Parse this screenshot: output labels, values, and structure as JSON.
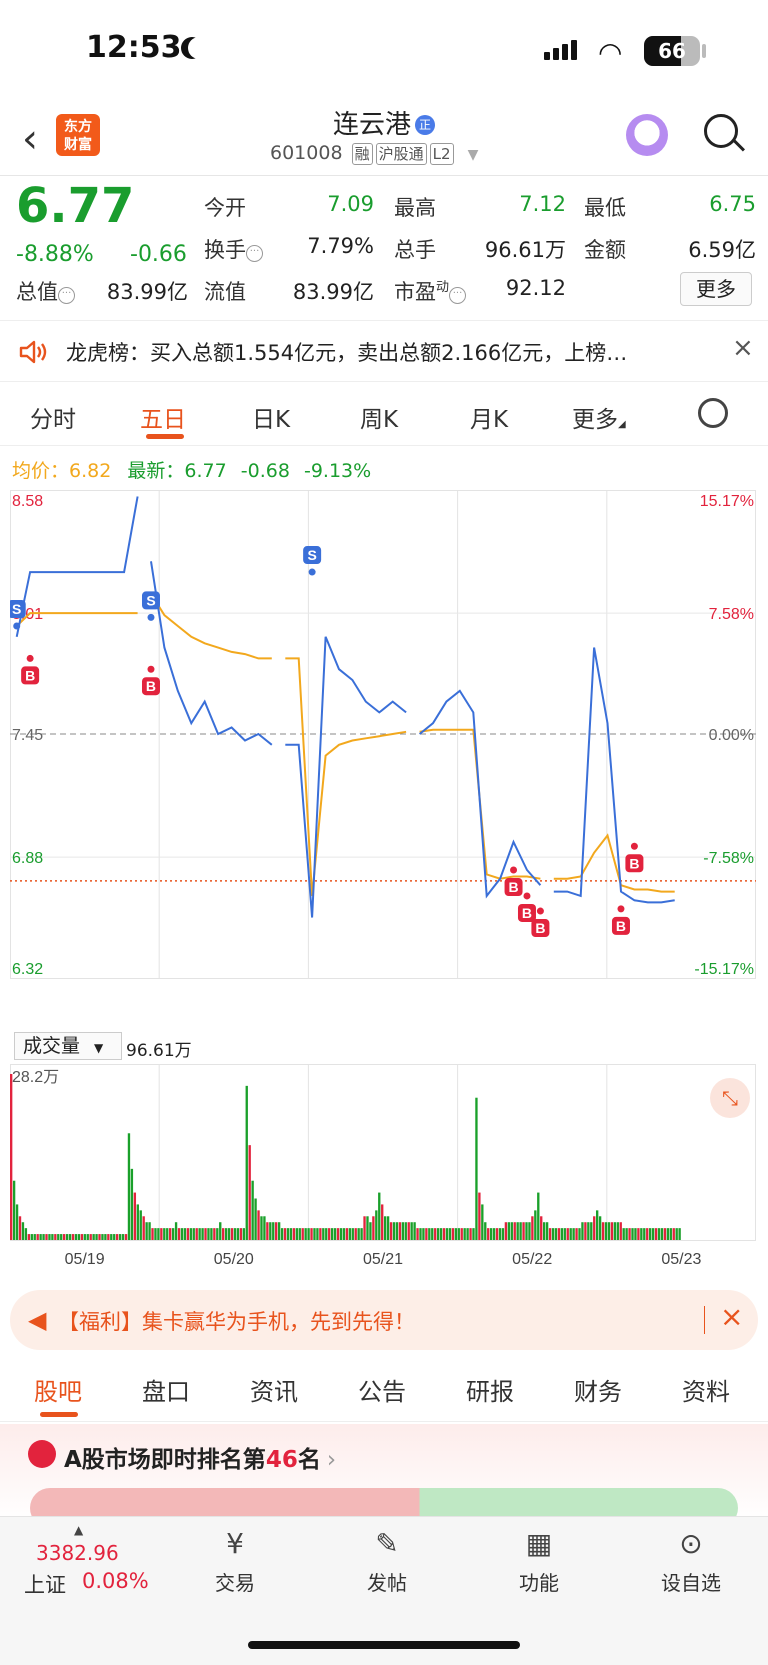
{
  "status_bar": {
    "time": "12:53",
    "battery": "66"
  },
  "header": {
    "logo_line1": "东方",
    "logo_line2": "财富",
    "stock_name": "连云港",
    "name_badge": "正",
    "code": "601008",
    "tags": [
      "融",
      "沪股通",
      "L2"
    ]
  },
  "quote": {
    "price": "6.77",
    "change_pct": "-8.88%",
    "change": "-0.66",
    "fields": [
      {
        "label": "今开",
        "value": "7.09",
        "color": "#1a9d2e"
      },
      {
        "label": "最高",
        "value": "7.12",
        "color": "#1a9d2e"
      },
      {
        "label": "最低",
        "value": "6.75",
        "color": "#1a9d2e"
      },
      {
        "label": "换手",
        "value": "7.79%",
        "color": "#222222"
      },
      {
        "label": "总手",
        "value": "96.61万",
        "color": "#222222"
      },
      {
        "label": "金额",
        "value": "6.59亿",
        "color": "#222222"
      },
      {
        "label": "总值",
        "value": "83.99亿",
        "color": "#222222"
      },
      {
        "label": "流值",
        "value": "83.99亿",
        "color": "#222222"
      },
      {
        "label": "市盈",
        "value": "92.12",
        "color": "#222222",
        "sup": "动"
      }
    ],
    "more_label": "更多"
  },
  "notice": {
    "text": "龙虎榜：买入总额1.554亿元，卖出总额2.166亿元，上榜…"
  },
  "chart_tabs": {
    "items": [
      "分时",
      "五日",
      "日K",
      "周K",
      "月K",
      "更多"
    ],
    "active": "五日"
  },
  "legend": {
    "avg_label": "均价：",
    "avg_value": "6.82",
    "latest_label": "最新：",
    "latest_value": "6.77",
    "latest_change": "-0.68",
    "latest_pct": "-9.13%"
  },
  "chart_data": {
    "type": "line",
    "title": "",
    "x_days": [
      "05/19",
      "05/20",
      "05/21",
      "05/22",
      "05/23"
    ],
    "y_left_ticks": [
      "8.58",
      "8.01",
      "7.45",
      "6.88",
      "6.32"
    ],
    "y_right_ticks": [
      "15.17%",
      "7.58%",
      "0.00%",
      "-7.58%",
      "-15.17%"
    ],
    "ylim": [
      6.32,
      8.58
    ],
    "prev_close": 7.45,
    "last_price_line": 6.77,
    "series": [
      {
        "name": "",
        "color": "#3a6fd8",
        "values": [
          7.9,
          8.2,
          8.2,
          8.2,
          8.2,
          8.2,
          8.2,
          8.2,
          8.2,
          8.55,
          8.25,
          7.85,
          7.65,
          7.5,
          7.6,
          7.45,
          7.48,
          7.42,
          7.45,
          7.4,
          7.4,
          7.4,
          6.6,
          7.9,
          7.75,
          7.7,
          7.6,
          7.55,
          7.6,
          7.55,
          7.45,
          7.5,
          7.6,
          7.65,
          7.55,
          6.7,
          6.78,
          6.95,
          6.82,
          6.75,
          6.72,
          6.72,
          6.7,
          7.85,
          7.5,
          6.72,
          6.68,
          6.67,
          6.67,
          6.68
        ]
      },
      {
        "name": "",
        "color": "#f2a81d",
        "values": [
          7.95,
          8.01,
          8.01,
          8.01,
          8.01,
          8.01,
          8.01,
          8.01,
          8.01,
          8.01,
          8.1,
          8.0,
          7.95,
          7.9,
          7.87,
          7.85,
          7.83,
          7.82,
          7.8,
          7.8,
          7.8,
          7.8,
          6.7,
          7.35,
          7.4,
          7.42,
          7.43,
          7.44,
          7.45,
          7.46,
          7.46,
          7.47,
          7.47,
          7.47,
          7.47,
          6.8,
          6.78,
          6.79,
          6.79,
          6.78,
          6.78,
          6.78,
          6.79,
          6.9,
          6.98,
          6.75,
          6.73,
          6.73,
          6.72,
          6.72
        ]
      }
    ],
    "trade_marks": [
      {
        "type": "S",
        "x": 0,
        "y": 7.95
      },
      {
        "type": "B",
        "x": 1,
        "y": 7.8
      },
      {
        "type": "S",
        "x": 10,
        "y": 7.99
      },
      {
        "type": "B",
        "x": 10,
        "y": 7.75
      },
      {
        "type": "S",
        "x": 22,
        "y": 8.2
      },
      {
        "type": "B",
        "x": 37,
        "y": 6.82
      },
      {
        "type": "B",
        "x": 38,
        "y": 6.7
      },
      {
        "type": "B",
        "x": 39,
        "y": 6.63
      },
      {
        "type": "B",
        "x": 46,
        "y": 6.93
      },
      {
        "type": "B",
        "x": 45,
        "y": 6.64
      }
    ]
  },
  "volume": {
    "selector": "成交量",
    "total": "96.61万",
    "max_label": "28.2万",
    "bars": [
      28,
      10,
      6,
      4,
      3,
      2,
      1,
      1,
      1,
      1,
      1,
      1,
      1,
      1,
      1,
      1,
      1,
      1,
      1,
      1,
      1,
      1,
      1,
      1,
      1,
      1,
      1,
      1,
      1,
      1,
      1,
      1,
      1,
      1,
      1,
      1,
      1,
      1,
      1,
      1,
      18,
      12,
      8,
      6,
      5,
      4,
      3,
      3,
      2,
      2,
      2,
      2,
      2,
      2,
      2,
      2,
      3,
      2,
      2,
      2,
      2,
      2,
      2,
      2,
      2,
      2,
      2,
      2,
      2,
      2,
      2,
      3,
      2,
      2,
      2,
      2,
      2,
      2,
      2,
      2,
      26,
      16,
      10,
      7,
      5,
      4,
      4,
      3,
      3,
      3,
      3,
      3,
      2,
      2,
      2,
      2,
      2,
      2,
      2,
      2,
      2,
      2,
      2,
      2,
      2,
      2,
      2,
      2,
      2,
      2,
      2,
      2,
      2,
      2,
      2,
      2,
      2,
      2,
      2,
      2,
      4,
      4,
      3,
      4,
      5,
      8,
      6,
      4,
      4,
      3,
      3,
      3,
      3,
      3,
      3,
      3,
      3,
      3,
      2,
      2,
      2,
      2,
      2,
      2,
      2,
      2,
      2,
      2,
      2,
      2,
      2,
      2,
      2,
      2,
      2,
      2,
      2,
      2,
      24,
      8,
      6,
      3,
      2,
      2,
      2,
      2,
      2,
      2,
      3,
      3,
      3,
      3,
      3,
      3,
      3,
      3,
      3,
      4,
      5,
      8,
      4,
      3,
      3,
      2,
      2,
      2,
      2,
      2,
      2,
      2,
      2,
      2,
      2,
      2,
      3,
      3,
      3,
      3,
      4,
      5,
      4,
      3,
      3,
      3,
      3,
      3,
      3,
      3,
      2,
      2,
      2,
      2,
      2,
      2,
      2,
      2,
      2,
      2,
      2,
      2,
      2,
      2,
      2,
      2,
      2,
      2,
      2,
      2
    ],
    "up_color": "#e2233d",
    "down_color": "#1aa02a"
  },
  "promo": {
    "text": "【福利】集卡赢华为手机，先到先得！"
  },
  "bottom_tabs": {
    "items": [
      "股吧",
      "盘口",
      "资讯",
      "公告",
      "研报",
      "财务",
      "资料"
    ],
    "active": "股吧"
  },
  "rank": {
    "text": "A股市场即时排名第",
    "rank_num": "46",
    "suffix": "名"
  },
  "bottom_bar": {
    "index_value": "3382.96",
    "index_name": "上证",
    "index_pct": "0.08%",
    "buttons": [
      {
        "label": "交易",
        "icon": "yen-icon"
      },
      {
        "label": "发帖",
        "icon": "edit-icon"
      },
      {
        "label": "功能",
        "icon": "grid-icon"
      },
      {
        "label": "设自选",
        "icon": "more-icon"
      }
    ]
  }
}
